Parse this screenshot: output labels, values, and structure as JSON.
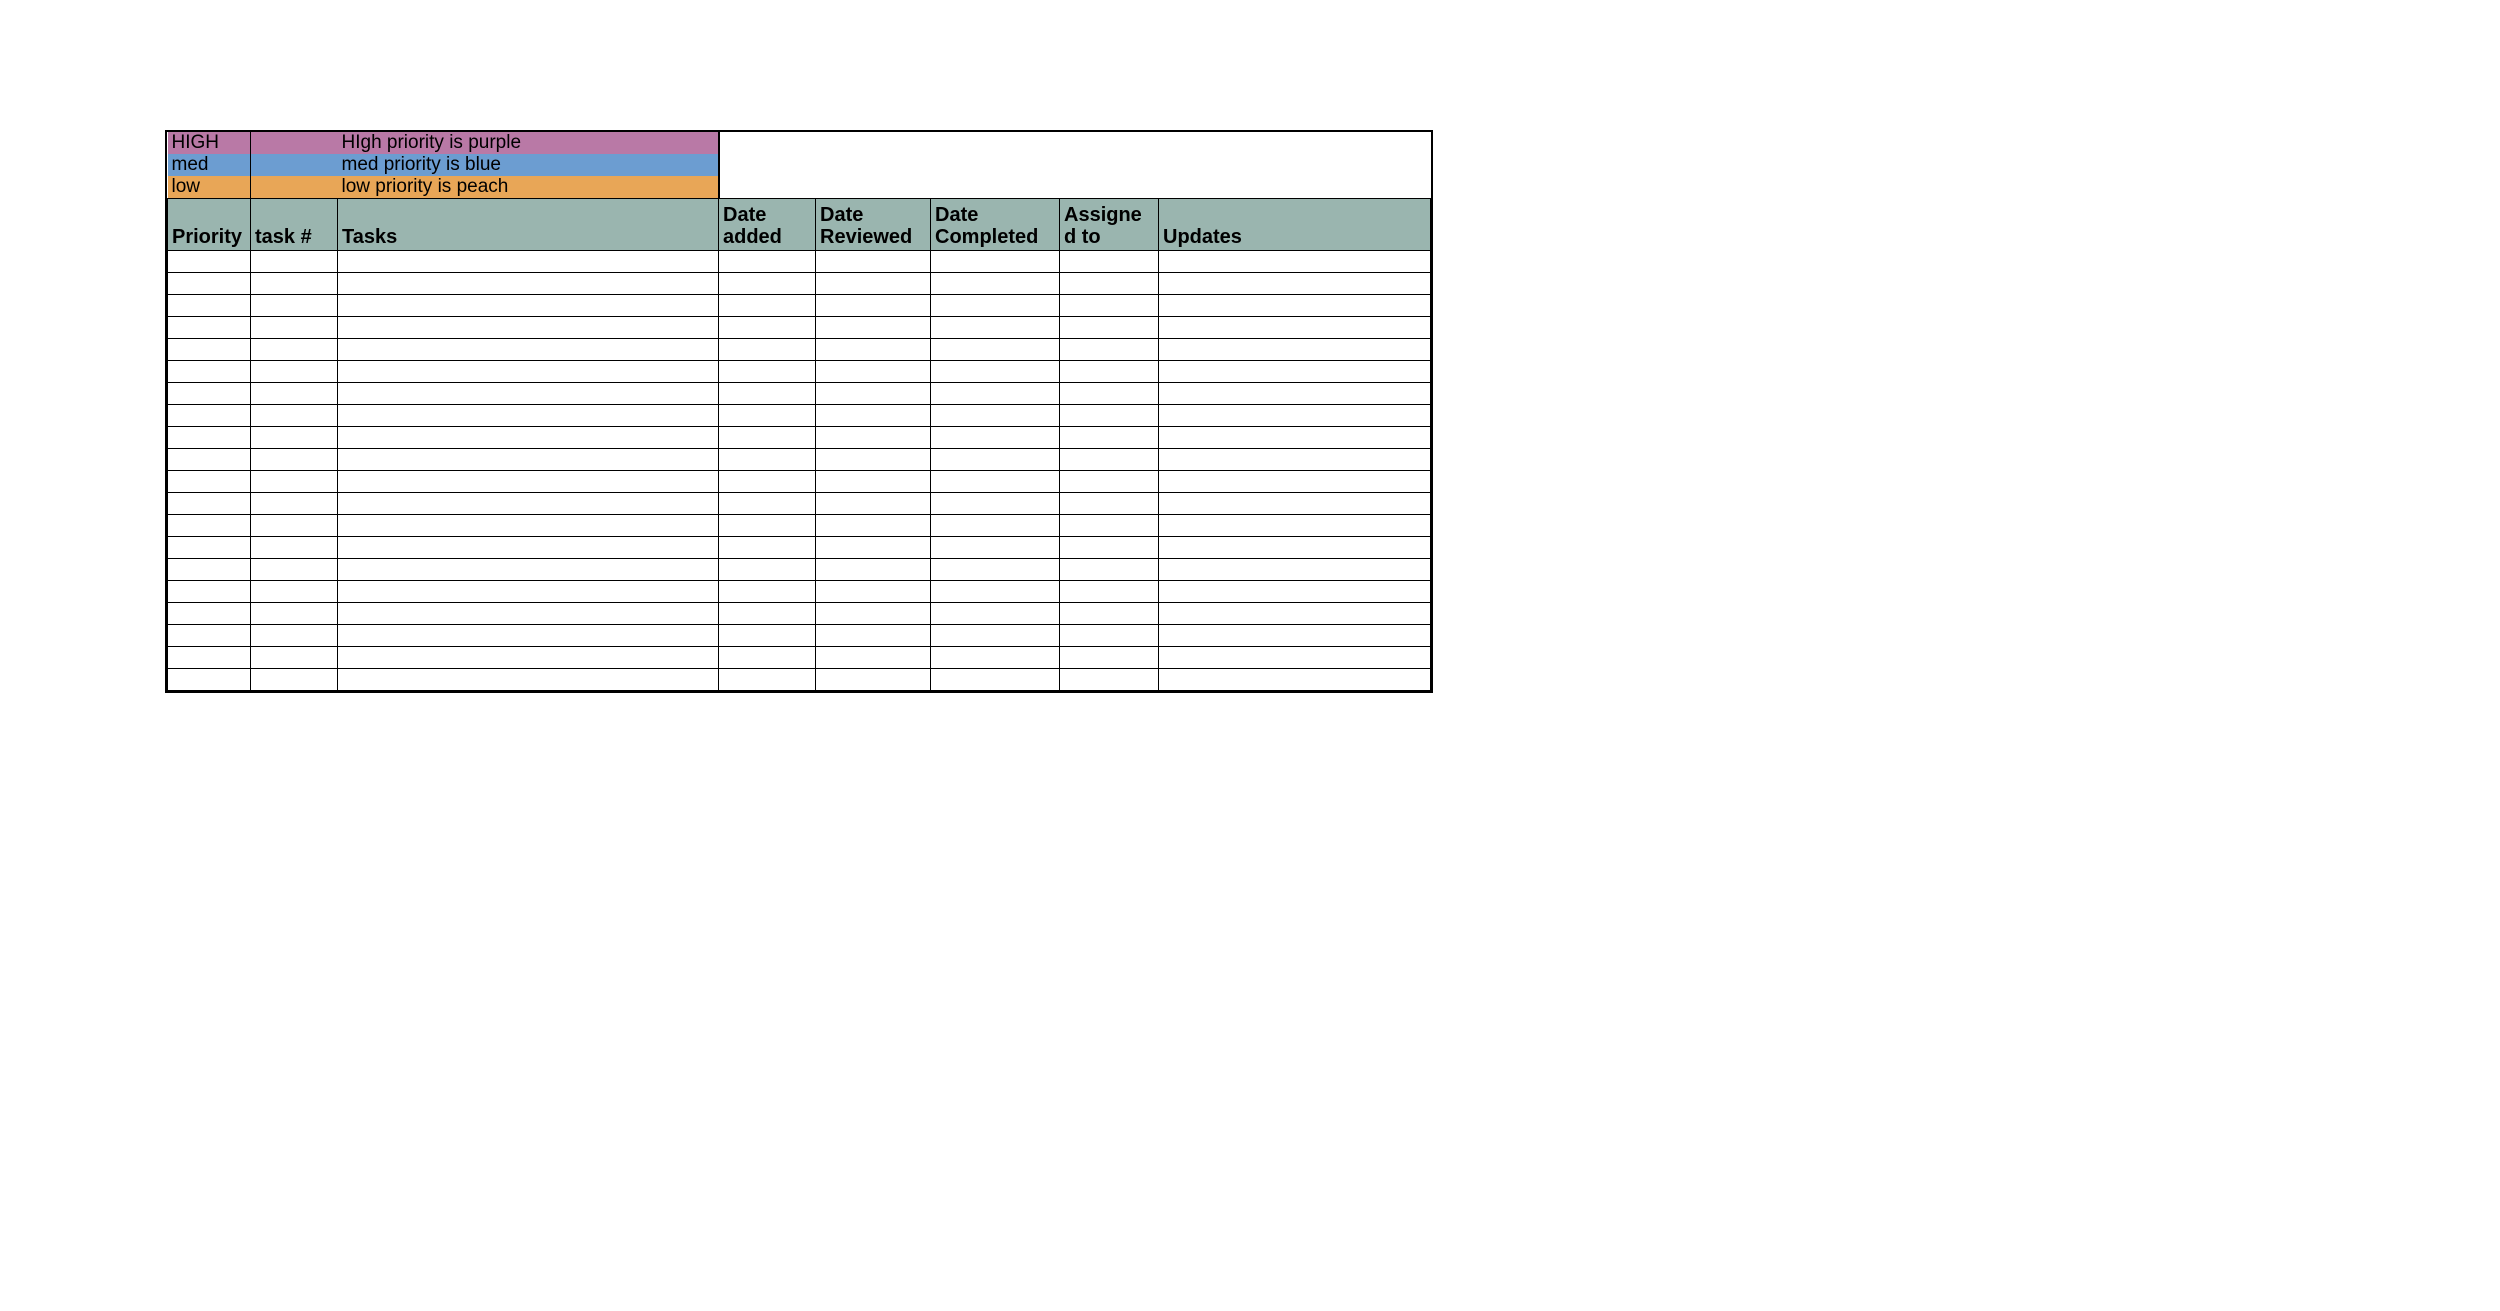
{
  "legend": {
    "high": {
      "label": "HIGH",
      "desc": "HIgh priority is purple"
    },
    "med": {
      "label": "med",
      "desc": "med priority is blue"
    },
    "low": {
      "label": "low",
      "desc": "low priority is peach"
    }
  },
  "headers": {
    "priority": "Priority",
    "tasknum": "task #",
    "tasks": "Tasks",
    "dateadd": "Date added",
    "daterev": "Date Reviewed",
    "datecomp": "Date Completed",
    "assign": "Assigned to",
    "updates": "Updates"
  },
  "rows": [
    {
      "priority": "",
      "tasknum": "",
      "tasks": "",
      "dateadd": "",
      "daterev": "",
      "datecomp": "",
      "assign": "",
      "updates": ""
    },
    {
      "priority": "",
      "tasknum": "",
      "tasks": "",
      "dateadd": "",
      "daterev": "",
      "datecomp": "",
      "assign": "",
      "updates": ""
    },
    {
      "priority": "",
      "tasknum": "",
      "tasks": "",
      "dateadd": "",
      "daterev": "",
      "datecomp": "",
      "assign": "",
      "updates": ""
    },
    {
      "priority": "",
      "tasknum": "",
      "tasks": "",
      "dateadd": "",
      "daterev": "",
      "datecomp": "",
      "assign": "",
      "updates": ""
    },
    {
      "priority": "",
      "tasknum": "",
      "tasks": "",
      "dateadd": "",
      "daterev": "",
      "datecomp": "",
      "assign": "",
      "updates": ""
    },
    {
      "priority": "",
      "tasknum": "",
      "tasks": "",
      "dateadd": "",
      "daterev": "",
      "datecomp": "",
      "assign": "",
      "updates": ""
    },
    {
      "priority": "",
      "tasknum": "",
      "tasks": "",
      "dateadd": "",
      "daterev": "",
      "datecomp": "",
      "assign": "",
      "updates": ""
    },
    {
      "priority": "",
      "tasknum": "",
      "tasks": "",
      "dateadd": "",
      "daterev": "",
      "datecomp": "",
      "assign": "",
      "updates": ""
    },
    {
      "priority": "",
      "tasknum": "",
      "tasks": "",
      "dateadd": "",
      "daterev": "",
      "datecomp": "",
      "assign": "",
      "updates": ""
    },
    {
      "priority": "",
      "tasknum": "",
      "tasks": "",
      "dateadd": "",
      "daterev": "",
      "datecomp": "",
      "assign": "",
      "updates": ""
    },
    {
      "priority": "",
      "tasknum": "",
      "tasks": "",
      "dateadd": "",
      "daterev": "",
      "datecomp": "",
      "assign": "",
      "updates": ""
    },
    {
      "priority": "",
      "tasknum": "",
      "tasks": "",
      "dateadd": "",
      "daterev": "",
      "datecomp": "",
      "assign": "",
      "updates": ""
    },
    {
      "priority": "",
      "tasknum": "",
      "tasks": "",
      "dateadd": "",
      "daterev": "",
      "datecomp": "",
      "assign": "",
      "updates": ""
    },
    {
      "priority": "",
      "tasknum": "",
      "tasks": "",
      "dateadd": "",
      "daterev": "",
      "datecomp": "",
      "assign": "",
      "updates": ""
    },
    {
      "priority": "",
      "tasknum": "",
      "tasks": "",
      "dateadd": "",
      "daterev": "",
      "datecomp": "",
      "assign": "",
      "updates": ""
    },
    {
      "priority": "",
      "tasknum": "",
      "tasks": "",
      "dateadd": "",
      "daterev": "",
      "datecomp": "",
      "assign": "",
      "updates": ""
    },
    {
      "priority": "",
      "tasknum": "",
      "tasks": "",
      "dateadd": "",
      "daterev": "",
      "datecomp": "",
      "assign": "",
      "updates": ""
    },
    {
      "priority": "",
      "tasknum": "",
      "tasks": "",
      "dateadd": "",
      "daterev": "",
      "datecomp": "",
      "assign": "",
      "updates": ""
    },
    {
      "priority": "",
      "tasknum": "",
      "tasks": "",
      "dateadd": "",
      "daterev": "",
      "datecomp": "",
      "assign": "",
      "updates": ""
    },
    {
      "priority": "",
      "tasknum": "",
      "tasks": "",
      "dateadd": "",
      "daterev": "",
      "datecomp": "",
      "assign": "",
      "updates": ""
    }
  ]
}
